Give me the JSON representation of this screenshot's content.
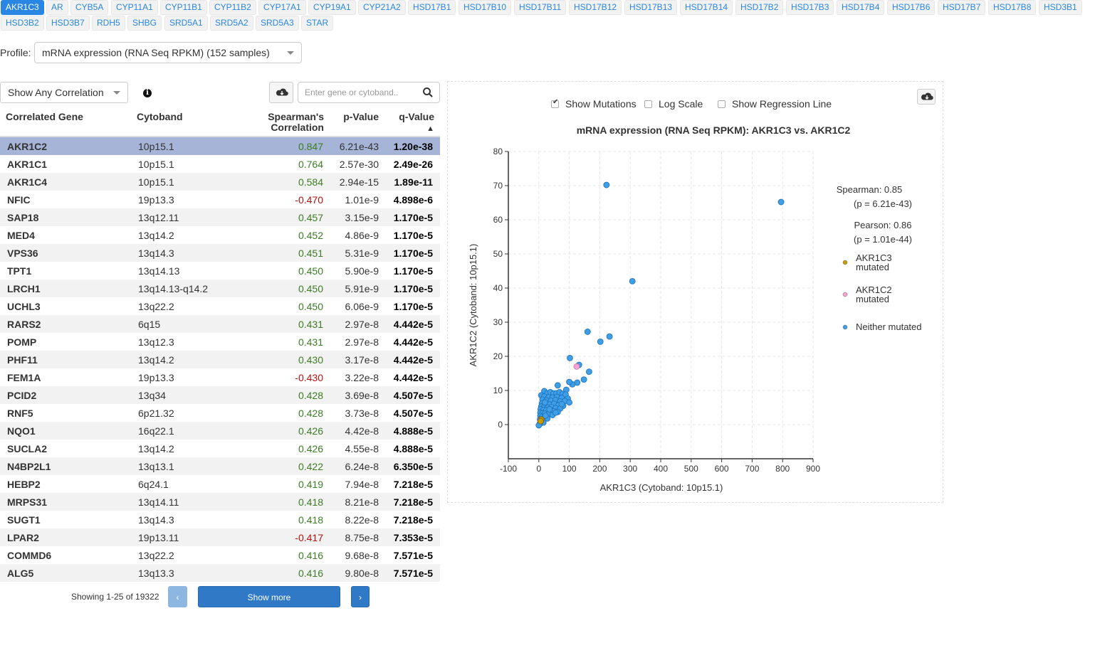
{
  "gene_tabs": {
    "active": "AKR1C3",
    "items": [
      "AKR1C3",
      "AR",
      "CYB5A",
      "CYP11A1",
      "CYP11B1",
      "CYP11B2",
      "CYP17A1",
      "CYP19A1",
      "CYP21A2",
      "HSD17B1",
      "HSD17B10",
      "HSD17B11",
      "HSD17B12",
      "HSD17B13",
      "HSD17B14",
      "HSD17B2",
      "HSD17B3",
      "HSD17B4",
      "HSD17B6",
      "HSD17B7",
      "HSD17B8",
      "HSD3B1",
      "HSD3B2",
      "HSD3B7",
      "RDH5",
      "SHBG",
      "SRD5A1",
      "SRD5A2",
      "SRD5A3",
      "STAR"
    ]
  },
  "profile": {
    "label": "Profile:",
    "selected": "mRNA expression (RNA Seq RPKM) (152 samples)"
  },
  "correlation_filter": {
    "selected": "Show Any Correlation"
  },
  "search": {
    "placeholder": "Enter gene or cytoband.."
  },
  "table": {
    "columns": {
      "gene": "Correlated Gene",
      "cytoband": "Cytoband",
      "spearman_line1": "Spearman's",
      "spearman_line2": "Correlation",
      "pvalue": "p-Value",
      "qvalue": "q-Value",
      "sort_indicator": "▲"
    },
    "rows": [
      {
        "gene": "AKR1C2",
        "cytoband": "10p15.1",
        "corr": "0.847",
        "p": "6.21e-43",
        "q": "1.20e-38"
      },
      {
        "gene": "AKR1C1",
        "cytoband": "10p15.1",
        "corr": "0.764",
        "p": "2.57e-30",
        "q": "2.49e-26"
      },
      {
        "gene": "AKR1C4",
        "cytoband": "10p15.1",
        "corr": "0.584",
        "p": "2.94e-15",
        "q": "1.89e-11"
      },
      {
        "gene": "NFIC",
        "cytoband": "19p13.3",
        "corr": "-0.470",
        "p": "1.01e-9",
        "q": "4.898e-6"
      },
      {
        "gene": "SAP18",
        "cytoband": "13q12.11",
        "corr": "0.457",
        "p": "3.15e-9",
        "q": "1.170e-5"
      },
      {
        "gene": "MED4",
        "cytoband": "13q14.2",
        "corr": "0.452",
        "p": "4.86e-9",
        "q": "1.170e-5"
      },
      {
        "gene": "VPS36",
        "cytoband": "13q14.3",
        "corr": "0.451",
        "p": "5.31e-9",
        "q": "1.170e-5"
      },
      {
        "gene": "TPT1",
        "cytoband": "13q14.13",
        "corr": "0.450",
        "p": "5.90e-9",
        "q": "1.170e-5"
      },
      {
        "gene": "LRCH1",
        "cytoband": "13q14.13-q14.2",
        "corr": "0.450",
        "p": "5.91e-9",
        "q": "1.170e-5"
      },
      {
        "gene": "UCHL3",
        "cytoband": "13q22.2",
        "corr": "0.450",
        "p": "6.06e-9",
        "q": "1.170e-5"
      },
      {
        "gene": "RARS2",
        "cytoband": "6q15",
        "corr": "0.431",
        "p": "2.97e-8",
        "q": "4.442e-5"
      },
      {
        "gene": "POMP",
        "cytoband": "13q12.3",
        "corr": "0.431",
        "p": "2.97e-8",
        "q": "4.442e-5"
      },
      {
        "gene": "PHF11",
        "cytoband": "13q14.2",
        "corr": "0.430",
        "p": "3.17e-8",
        "q": "4.442e-5"
      },
      {
        "gene": "FEM1A",
        "cytoband": "19p13.3",
        "corr": "-0.430",
        "p": "3.22e-8",
        "q": "4.442e-5"
      },
      {
        "gene": "PCID2",
        "cytoband": "13q34",
        "corr": "0.428",
        "p": "3.69e-8",
        "q": "4.507e-5"
      },
      {
        "gene": "RNF5",
        "cytoband": "6p21.32",
        "corr": "0.428",
        "p": "3.73e-8",
        "q": "4.507e-5"
      },
      {
        "gene": "NQO1",
        "cytoband": "16q22.1",
        "corr": "0.426",
        "p": "4.42e-8",
        "q": "4.888e-5"
      },
      {
        "gene": "SUCLA2",
        "cytoband": "13q14.2",
        "corr": "0.426",
        "p": "4.55e-8",
        "q": "4.888e-5"
      },
      {
        "gene": "N4BP2L1",
        "cytoband": "13q13.1",
        "corr": "0.422",
        "p": "6.24e-8",
        "q": "6.350e-5"
      },
      {
        "gene": "HEBP2",
        "cytoband": "6q24.1",
        "corr": "0.419",
        "p": "7.94e-8",
        "q": "7.218e-5"
      },
      {
        "gene": "MRPS31",
        "cytoband": "13q14.11",
        "corr": "0.418",
        "p": "8.21e-8",
        "q": "7.218e-5"
      },
      {
        "gene": "SUGT1",
        "cytoband": "13q14.3",
        "corr": "0.418",
        "p": "8.22e-8",
        "q": "7.218e-5"
      },
      {
        "gene": "LPAR2",
        "cytoband": "19p13.11",
        "corr": "-0.417",
        "p": "8.75e-8",
        "q": "7.353e-5"
      },
      {
        "gene": "COMMD6",
        "cytoband": "13q22.2",
        "corr": "0.416",
        "p": "9.68e-8",
        "q": "7.571e-5"
      },
      {
        "gene": "ALG5",
        "cytoband": "13q13.3",
        "corr": "0.416",
        "p": "9.80e-8",
        "q": "7.571e-5"
      }
    ]
  },
  "pagination": {
    "status": "Showing 1-25 of 19322",
    "prev_label": "‹",
    "more_label": "Show more",
    "next_label": "›"
  },
  "plot_options": {
    "show_mutations": {
      "label": "Show Mutations",
      "checked": true
    },
    "log_scale": {
      "label": "Log Scale",
      "checked": false
    },
    "regression": {
      "label": "Show Regression Line",
      "checked": false
    }
  },
  "chart_data": {
    "type": "scatter",
    "title": "mRNA expression (RNA Seq RPKM): AKR1C3 vs. AKR1C2",
    "xlabel": "AKR1C3 (Cytoband: 10p15.1)",
    "ylabel": "AKR1C2 (Cytoband: 10p15.1)",
    "xlim": [
      -100,
      900
    ],
    "ylim": [
      -10,
      80
    ],
    "xticks": [
      -100,
      0,
      100,
      200,
      300,
      400,
      500,
      600,
      700,
      800,
      900
    ],
    "yticks": [
      0,
      10,
      20,
      30,
      40,
      50,
      60,
      70,
      80
    ],
    "grid": true,
    "legend_position": "right",
    "stats": {
      "spearman": "Spearman: 0.85",
      "spearman_p": "(p = 6.21e-43)",
      "pearson": "Pearson: 0.86",
      "pearson_p": "(p = 1.01e-44)"
    },
    "series": [
      {
        "name": "AKR1C3 mutated",
        "legend_line1": "AKR1C3",
        "legend_line2": "mutated",
        "color": "#c99b06",
        "points": [
          [
            8,
            1.5
          ],
          [
            6,
            1
          ]
        ]
      },
      {
        "name": "AKR1C2 mutated",
        "legend_line1": "AKR1C2",
        "legend_line2": "mutated",
        "color": "#f4a3d3",
        "points": [
          [
            124,
            17
          ]
        ]
      },
      {
        "name": "Neither mutated",
        "legend_line1": "Neither mutated",
        "legend_line2": "",
        "color": "#3e9fe8",
        "points": [
          [
            222,
            70.2
          ],
          [
            795,
            65.2
          ],
          [
            307,
            42
          ],
          [
            160,
            27.2
          ],
          [
            232,
            25.8
          ],
          [
            202,
            24.3
          ],
          [
            102,
            19.5
          ],
          [
            132,
            17.5
          ],
          [
            165,
            15.5
          ],
          [
            148,
            13.2
          ],
          [
            126,
            12.3
          ],
          [
            110,
            11.8
          ],
          [
            100,
            12.5
          ],
          [
            62,
            11.5
          ],
          [
            90,
            10.2
          ],
          [
            18,
            9.8
          ],
          [
            28,
            9.2
          ],
          [
            38,
            9.5
          ],
          [
            48,
            9.1
          ],
          [
            58,
            9.2
          ],
          [
            68,
            9.5
          ],
          [
            78,
            9.0
          ],
          [
            88,
            8.8
          ],
          [
            8,
            8.6
          ],
          [
            18,
            8.2
          ],
          [
            32,
            8.0
          ],
          [
            45,
            7.9
          ],
          [
            60,
            8.1
          ],
          [
            75,
            7.8
          ],
          [
            95,
            7.6
          ],
          [
            12,
            7.3
          ],
          [
            25,
            7.1
          ],
          [
            40,
            7.0
          ],
          [
            55,
            7.2
          ],
          [
            70,
            6.8
          ],
          [
            85,
            6.9
          ],
          [
            100,
            6.5
          ],
          [
            10,
            6.2
          ],
          [
            22,
            6.0
          ],
          [
            35,
            5.9
          ],
          [
            50,
            6.1
          ],
          [
            65,
            5.7
          ],
          [
            80,
            5.5
          ],
          [
            8,
            5.3
          ],
          [
            18,
            5.2
          ],
          [
            30,
            5.0
          ],
          [
            42,
            5.1
          ],
          [
            55,
            4.8
          ],
          [
            70,
            4.7
          ],
          [
            6,
            4.5
          ],
          [
            15,
            4.3
          ],
          [
            25,
            4.2
          ],
          [
            38,
            4.1
          ],
          [
            50,
            3.9
          ],
          [
            62,
            3.7
          ],
          [
            5,
            3.5
          ],
          [
            12,
            3.3
          ],
          [
            20,
            3.2
          ],
          [
            32,
            3.0
          ],
          [
            45,
            2.8
          ],
          [
            5,
            2.5
          ],
          [
            10,
            2.2
          ],
          [
            18,
            2.0
          ],
          [
            28,
            1.8
          ],
          [
            4,
            1.5
          ],
          [
            9,
            1.0
          ],
          [
            15,
            0.6
          ],
          [
            3,
            0.2
          ],
          [
            0,
            -0.2
          ],
          [
            22,
            2.6
          ],
          [
            55,
            3.5
          ],
          [
            35,
            4.5
          ],
          [
            20,
            6.5
          ],
          [
            75,
            6.0
          ]
        ]
      }
    ]
  }
}
